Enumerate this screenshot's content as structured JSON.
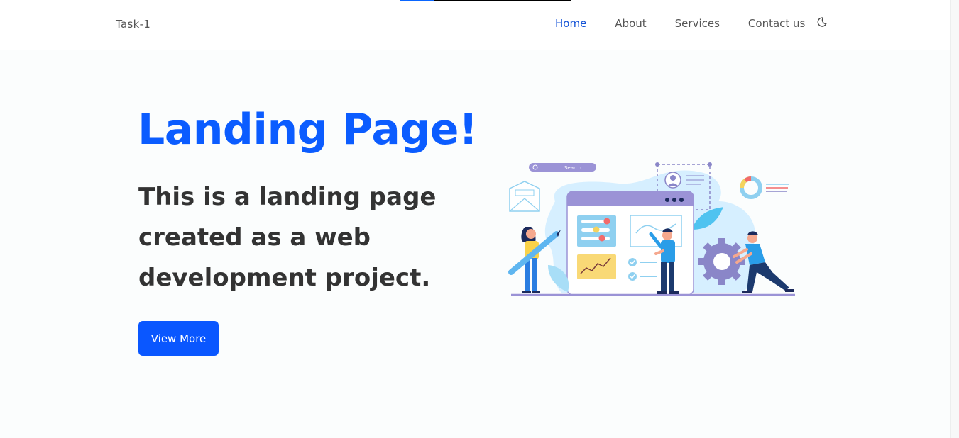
{
  "header": {
    "logo": "Task-1",
    "nav": [
      {
        "label": "Home",
        "active": true
      },
      {
        "label": "About",
        "active": false
      },
      {
        "label": "Services",
        "active": false
      },
      {
        "label": "Contact us",
        "active": false
      }
    ],
    "theme_icon": "moon-icon",
    "scroll_progress": 0.2
  },
  "hero": {
    "title": "Landing Page!",
    "subtitle": "This is a landing page created as a web development project.",
    "button_label": "View More",
    "illustration": {
      "search_label": "Search",
      "icons": [
        "envelope-icon",
        "profile-card-icon",
        "donut-chart-icon",
        "gear-icon",
        "pencil-icon",
        "line-chart-icon",
        "checkmark-icon",
        "leaf-icon"
      ]
    }
  },
  "colors": {
    "accent": "#0b5cff",
    "button": "#0a57ff",
    "active_nav": "#1453d6",
    "text": "#333333"
  }
}
